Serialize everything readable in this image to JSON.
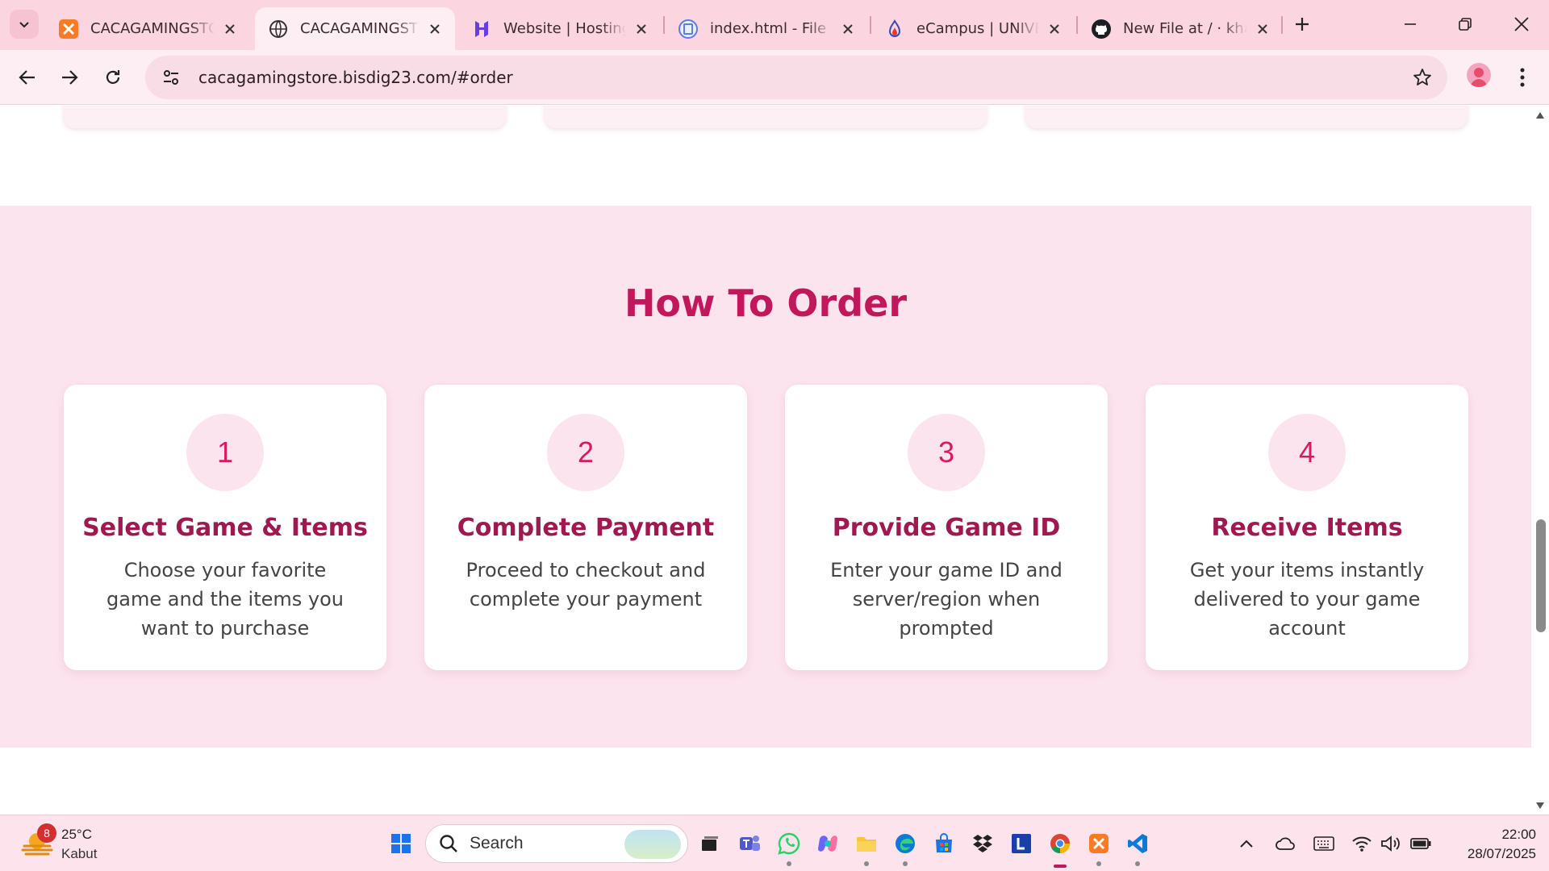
{
  "browser": {
    "tabs": [
      {
        "title": "CACAGAMINGSTORE",
        "favicon": "xampp-icon",
        "active": false
      },
      {
        "title": "CACAGAMINGSTORE",
        "favicon": "globe-icon",
        "active": true
      },
      {
        "title": "Website | Hostinger",
        "favicon": "hostinger-icon",
        "active": false
      },
      {
        "title": "index.html - File - Hostinger",
        "favicon": "file-manager-icon",
        "active": false
      },
      {
        "title": "eCampus | UNIVERSITAS",
        "favicon": "ecampus-icon",
        "active": false
      },
      {
        "title": "New File at / · khan",
        "favicon": "github-icon",
        "active": false
      }
    ],
    "url": "cacagamingstore.bisdig23.com/#order"
  },
  "page": {
    "section_title": "How To Order",
    "steps": [
      {
        "number": "1",
        "title": "Select Game & Items",
        "description": "Choose your favorite game and the items you want to purchase"
      },
      {
        "number": "2",
        "title": "Complete Payment",
        "description": "Proceed to checkout and complete your payment"
      },
      {
        "number": "3",
        "title": "Provide Game ID",
        "description": "Enter your game ID and server/region when prompted"
      },
      {
        "number": "4",
        "title": "Receive Items",
        "description": "Get your items instantly delivered to your game account"
      }
    ]
  },
  "taskbar": {
    "weather": {
      "badge": "8",
      "temp": "25°C",
      "condition": "Kabut"
    },
    "search_label": "Search",
    "clock": {
      "time": "22:00",
      "date": "28/07/2025"
    }
  },
  "colors": {
    "accent": "#c2185b",
    "section_bg": "#fce4ef",
    "chrome_bg": "#fbd5e0"
  }
}
